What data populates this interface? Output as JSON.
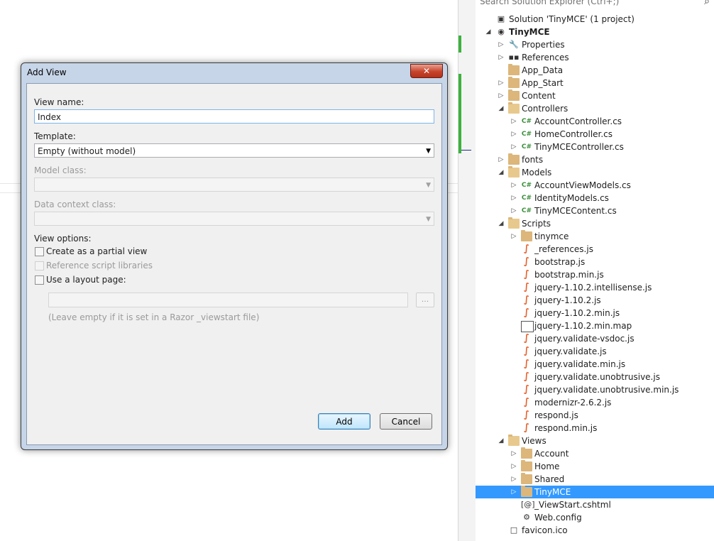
{
  "solution_explorer": {
    "search_placeholder": "Search Solution Explorer (Ctrl+;)",
    "items": [
      {
        "label": "Solution 'TinyMCE' (1 project)",
        "icon": "solution-icon"
      },
      {
        "label": "TinyMCE",
        "icon": "web-project-icon",
        "bold": true
      },
      {
        "label": "Properties",
        "icon": "wrench-icon"
      },
      {
        "label": "References",
        "icon": "references-icon"
      },
      {
        "label": "App_Data",
        "icon": "folder-icon"
      },
      {
        "label": "App_Start",
        "icon": "folder-icon"
      },
      {
        "label": "Content",
        "icon": "folder-icon"
      },
      {
        "label": "Controllers",
        "icon": "folder-open-icon"
      },
      {
        "label": "AccountController.cs",
        "icon": "csharp-file-icon"
      },
      {
        "label": "HomeController.cs",
        "icon": "csharp-file-icon"
      },
      {
        "label": "TinyMCEController.cs",
        "icon": "csharp-file-icon"
      },
      {
        "label": "fonts",
        "icon": "folder-icon"
      },
      {
        "label": "Models",
        "icon": "folder-open-icon"
      },
      {
        "label": "AccountViewModels.cs",
        "icon": "csharp-file-icon"
      },
      {
        "label": "IdentityModels.cs",
        "icon": "csharp-file-icon"
      },
      {
        "label": "TinyMCEContent.cs",
        "icon": "csharp-file-icon"
      },
      {
        "label": "Scripts",
        "icon": "folder-open-icon"
      },
      {
        "label": "tinymce",
        "icon": "folder-icon"
      },
      {
        "label": "_references.js",
        "icon": "js-file-icon"
      },
      {
        "label": "bootstrap.js",
        "icon": "js-file-icon"
      },
      {
        "label": "bootstrap.min.js",
        "icon": "js-file-icon"
      },
      {
        "label": "jquery-1.10.2.intellisense.js",
        "icon": "js-file-icon"
      },
      {
        "label": "jquery-1.10.2.js",
        "icon": "js-file-icon"
      },
      {
        "label": "jquery-1.10.2.min.js",
        "icon": "js-file-icon"
      },
      {
        "label": "jquery-1.10.2.min.map",
        "icon": "file-icon"
      },
      {
        "label": "jquery.validate-vsdoc.js",
        "icon": "js-file-icon"
      },
      {
        "label": "jquery.validate.js",
        "icon": "js-file-icon"
      },
      {
        "label": "jquery.validate.min.js",
        "icon": "js-file-icon"
      },
      {
        "label": "jquery.validate.unobtrusive.js",
        "icon": "js-file-icon"
      },
      {
        "label": "jquery.validate.unobtrusive.min.js",
        "icon": "js-file-icon"
      },
      {
        "label": "modernizr-2.6.2.js",
        "icon": "js-file-icon"
      },
      {
        "label": "respond.js",
        "icon": "js-file-icon"
      },
      {
        "label": "respond.min.js",
        "icon": "js-file-icon"
      },
      {
        "label": "Views",
        "icon": "folder-open-icon"
      },
      {
        "label": "Account",
        "icon": "folder-icon"
      },
      {
        "label": "Home",
        "icon": "folder-icon"
      },
      {
        "label": "Shared",
        "icon": "folder-icon"
      },
      {
        "label": "TinyMCE",
        "icon": "folder-icon",
        "selected": true
      },
      {
        "label": "_ViewStart.cshtml",
        "icon": "cshtml-file-icon"
      },
      {
        "label": "Web.config",
        "icon": "config-file-icon"
      },
      {
        "label": "favicon.ico",
        "icon": "ico-file-icon"
      }
    ]
  },
  "dialog": {
    "title": "Add View",
    "close_symbol": "✕",
    "view_name_label": "View name:",
    "view_name_value": "Index",
    "template_label": "Template:",
    "template_value": "Empty (without model)",
    "model_class_label": "Model class:",
    "model_class_value": "",
    "data_context_label": "Data context class:",
    "data_context_value": "",
    "view_options_label": "View options:",
    "partial_view_label": "Create as a partial view",
    "partial_view_checked": false,
    "reference_scripts_label": "Reference script libraries",
    "reference_scripts_enabled": false,
    "layout_page_label": "Use a layout page:",
    "layout_page_checked": false,
    "layout_path_value": "",
    "browse_label": "...",
    "layout_hint": "(Leave empty if it is set in a Razor _viewstart file)",
    "add_label": "Add",
    "cancel_label": "Cancel"
  },
  "colors": {
    "selection": "#3399ff",
    "dialog_frame": "#c6d5e8",
    "change_marker": "#3cb33c"
  }
}
